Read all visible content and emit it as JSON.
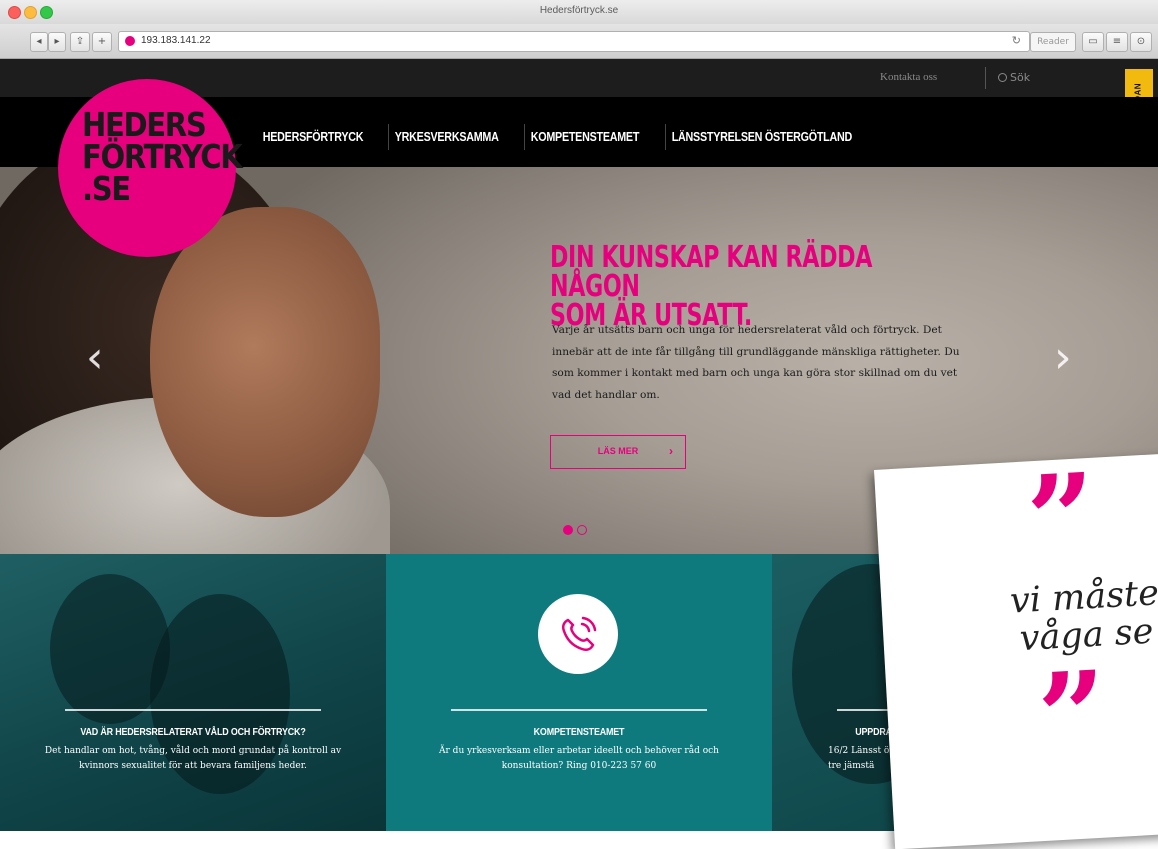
{
  "browser": {
    "window_title": "Hedersförtryck.se",
    "url": "193.183.141.22"
  },
  "site": {
    "topbar": {
      "contact": "Kontakta oss",
      "search": "Sök"
    },
    "quick_exit": "LÄMNA SIDAN",
    "logo": [
      "HEDERS",
      "FÖRTRYCK",
      ".SE"
    ],
    "nav": [
      "HEDERSFÖRTRYCK",
      "YRKESVERKSAMMA",
      "KOMPETENSTEAMET",
      "LÄNSSTYRELSEN ÖSTERGÖTLAND"
    ]
  },
  "hero": {
    "title_line1": "DIN KUNSKAP KAN RÄDDA NÅGON",
    "title_line2": "SOM ÄR UTSATT.",
    "body": "Varje år utsätts barn och unga för hedersrelaterat våld och förtryck. Det innebär att de inte får tillgång till grundläggande mänskliga rättigheter. Du som kommer i kontakt med barn och unga kan göra stor skillnad om du vet vad det handlar om.",
    "button": "LÄS MER",
    "prev_arrow": "‹",
    "next_arrow": "›",
    "slides": 2,
    "active_slide": 1
  },
  "panels": [
    {
      "title": "VAD ÄR HEDERSRELATERAT VÅLD OCH FÖRTRYCK?",
      "text": "Det handlar om hot, tvång, våld och mord grundat på kontroll av kvinnors sexualitet för att bevara familjens heder."
    },
    {
      "title": "KOMPETENSTEAMET",
      "text": "Är du yrkesverksam eller arbetar ideellt och behöver råd och konsultation? Ring 010-223 57 60"
    },
    {
      "title": "UPPDRA",
      "text": "16/2 Länsst över tre jämstä"
    }
  ],
  "quote": {
    "open": "”",
    "line1": "vi måste",
    "line2": "våga se",
    "close": "”"
  },
  "colors": {
    "brand_pink": "#e6007e",
    "teal": "#0f7a7e",
    "dark_teal": "#0f4347",
    "quick_exit_yellow": "#f2b90f"
  }
}
